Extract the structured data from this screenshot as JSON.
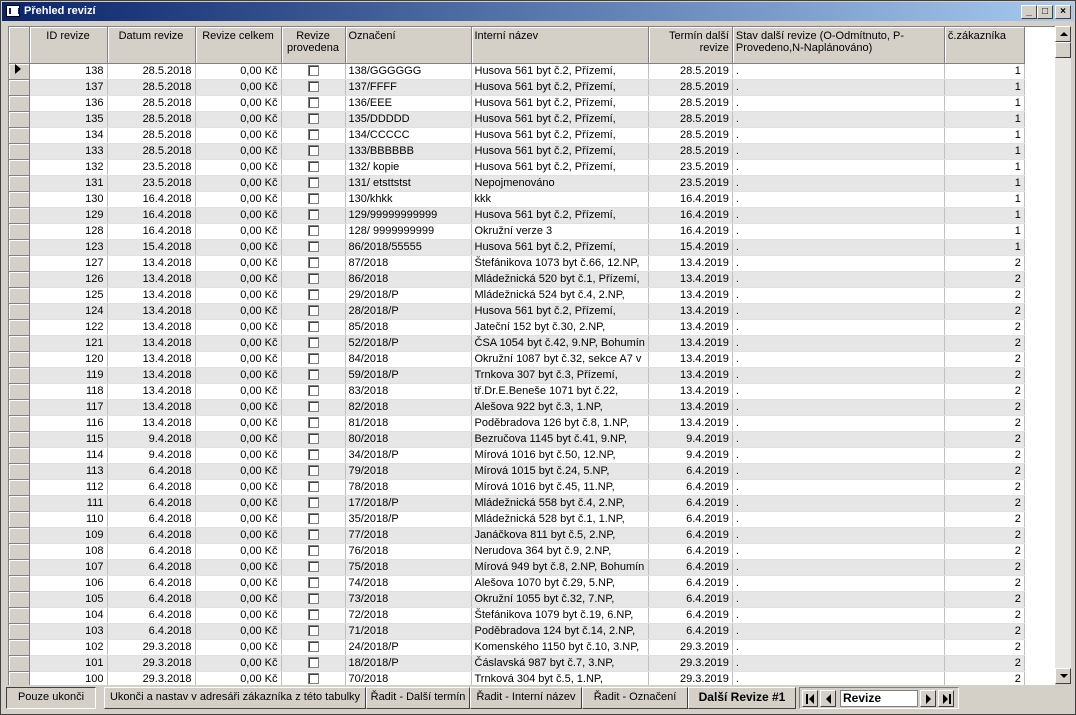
{
  "window": {
    "title": "Přehled revizí",
    "minimize": "_",
    "maximize": "□",
    "close": "×"
  },
  "columns": [
    {
      "key": "id",
      "label": "ID revize"
    },
    {
      "key": "datum",
      "label": "Datum revize"
    },
    {
      "key": "celkem",
      "label": "Revize celkem"
    },
    {
      "key": "provedena",
      "label": "Revize provedena"
    },
    {
      "key": "oznaceni",
      "label": "Označení"
    },
    {
      "key": "nazev",
      "label": "Interní název"
    },
    {
      "key": "termin",
      "label": "Termín další revize"
    },
    {
      "key": "stav",
      "label": "Stav další revize (O-Odmítnuto, P-Provedeno,N-Naplánováno)"
    },
    {
      "key": "zakaznik",
      "label": "č.zákazníka"
    }
  ],
  "rows": [
    [
      "138",
      "28.5.2018",
      "0,00 Kč",
      "138/GGGGGG",
      "Husova 561 byt č.2, Přízemí,",
      "28.5.2019",
      ".",
      "1"
    ],
    [
      "137",
      "28.5.2018",
      "0,00 Kč",
      "137/FFFF",
      "Husova 561 byt č.2, Přízemí,",
      "28.5.2019",
      ".",
      "1"
    ],
    [
      "136",
      "28.5.2018",
      "0,00 Kč",
      "136/EEE",
      "Husova 561 byt č.2, Přízemí,",
      "28.5.2019",
      ".",
      "1"
    ],
    [
      "135",
      "28.5.2018",
      "0,00 Kč",
      "135/DDDDD",
      "Husova 561 byt č.2, Přízemí,",
      "28.5.2019",
      ".",
      "1"
    ],
    [
      "134",
      "28.5.2018",
      "0,00 Kč",
      "134/CCCCC",
      "Husova 561 byt č.2, Přízemí,",
      "28.5.2019",
      ".",
      "1"
    ],
    [
      "133",
      "28.5.2018",
      "0,00 Kč",
      "133/BBBBBB",
      "Husova 561 byt č.2, Přízemí,",
      "28.5.2019",
      ".",
      "1"
    ],
    [
      "132",
      "23.5.2018",
      "0,00 Kč",
      "132/ kopie",
      "Husova 561 byt č.2, Přízemí,",
      "23.5.2019",
      ".",
      "1"
    ],
    [
      "131",
      "23.5.2018",
      "0,00 Kč",
      "131/ etsttstst",
      "Nepojmenováno",
      "23.5.2019",
      ".",
      "1"
    ],
    [
      "130",
      "16.4.2018",
      "0,00 Kč",
      "130/khkk",
      "kkk",
      "16.4.2019",
      ".",
      "1"
    ],
    [
      "129",
      "16.4.2018",
      "0,00 Kč",
      "129/99999999999",
      "Husova 561 byt č.2, Přízemí,",
      "16.4.2019",
      ".",
      "1"
    ],
    [
      "128",
      "16.4.2018",
      "0,00 Kč",
      "128/ 9999999999",
      "Okružní verze 3",
      "16.4.2019",
      ".",
      "1"
    ],
    [
      "123",
      "15.4.2018",
      "0,00 Kč",
      "86/2018/55555",
      "Husova 561 byt č.2, Přízemí,",
      "15.4.2019",
      ".",
      "1"
    ],
    [
      "127",
      "13.4.2018",
      "0,00 Kč",
      "87/2018",
      "Štefánikova 1073 byt č.66, 12.NP,",
      "13.4.2019",
      ".",
      "2"
    ],
    [
      "126",
      "13.4.2018",
      "0,00 Kč",
      "86/2018",
      "Mládežnická 520 byt č.1, Přízemí,",
      "13.4.2019",
      ".",
      "2"
    ],
    [
      "125",
      "13.4.2018",
      "0,00 Kč",
      "29/2018/P",
      "Mládežnická 524 byt č.4, 2.NP,",
      "13.4.2019",
      ".",
      "2"
    ],
    [
      "124",
      "13.4.2018",
      "0,00 Kč",
      "28/2018/P",
      "Husova 561 byt č.2, Přízemí,",
      "13.4.2019",
      ".",
      "2"
    ],
    [
      "122",
      "13.4.2018",
      "0,00 Kč",
      "85/2018",
      "Jateční 152 byt č.30, 2.NP,",
      "13.4.2019",
      ".",
      "2"
    ],
    [
      "121",
      "13.4.2018",
      "0,00 Kč",
      "52/2018/P",
      "ČSA 1054 byt č.42, 9.NP, Bohumín",
      "13.4.2019",
      ".",
      "2"
    ],
    [
      "120",
      "13.4.2018",
      "0,00 Kč",
      "84/2018",
      "Okružní 1087 byt č.32, sekce A7 v",
      "13.4.2019",
      ".",
      "2"
    ],
    [
      "119",
      "13.4.2018",
      "0,00 Kč",
      "59/2018/P",
      "Trnkova 307 byt č.3, Přízemí,",
      "13.4.2019",
      ".",
      "2"
    ],
    [
      "118",
      "13.4.2018",
      "0,00 Kč",
      "83/2018",
      "tř.Dr.E.Beneše 1071 byt č.22,",
      "13.4.2019",
      ".",
      "2"
    ],
    [
      "117",
      "13.4.2018",
      "0,00 Kč",
      "82/2018",
      "Alešova 922 byt č.3, 1.NP,",
      "13.4.2019",
      ".",
      "2"
    ],
    [
      "116",
      "13.4.2018",
      "0,00 Kč",
      "81/2018",
      "Poděbradova 126 byt č.8, 1.NP,",
      "13.4.2019",
      ".",
      "2"
    ],
    [
      "115",
      "9.4.2018",
      "0,00 Kč",
      "80/2018",
      "Bezručova 1145 byt č.41, 9.NP,",
      "9.4.2019",
      ".",
      "2"
    ],
    [
      "114",
      "9.4.2018",
      "0,00 Kč",
      "34/2018/P",
      "Mírová 1016 byt č.50, 12.NP,",
      "9.4.2019",
      ".",
      "2"
    ],
    [
      "113",
      "6.4.2018",
      "0,00 Kč",
      "79/2018",
      "Mírová 1015 byt č.24, 5.NP,",
      "6.4.2019",
      ".",
      "2"
    ],
    [
      "112",
      "6.4.2018",
      "0,00 Kč",
      "78/2018",
      "Mírová 1016 byt č.45, 11.NP,",
      "6.4.2019",
      ".",
      "2"
    ],
    [
      "111",
      "6.4.2018",
      "0,00 Kč",
      "17/2018/P",
      "Mládežnická 558 byt č.4, 2.NP,",
      "6.4.2019",
      ".",
      "2"
    ],
    [
      "110",
      "6.4.2018",
      "0,00 Kč",
      "35/2018/P",
      "Mládežnická 528 byt č.1, 1.NP,",
      "6.4.2019",
      ".",
      "2"
    ],
    [
      "109",
      "6.4.2018",
      "0,00 Kč",
      "77/2018",
      "Janáčkova 811 byt č.5, 2.NP,",
      "6.4.2019",
      ".",
      "2"
    ],
    [
      "108",
      "6.4.2018",
      "0,00 Kč",
      "76/2018",
      "Nerudova 364 byt č.9, 2.NP,",
      "6.4.2019",
      ".",
      "2"
    ],
    [
      "107",
      "6.4.2018",
      "0,00 Kč",
      "75/2018",
      "Mírová 949 byt č.8, 2.NP, Bohumín",
      "6.4.2019",
      ".",
      "2"
    ],
    [
      "106",
      "6.4.2018",
      "0,00 Kč",
      "74/2018",
      "Alešova 1070 byt č.29, 5.NP,",
      "6.4.2019",
      ".",
      "2"
    ],
    [
      "105",
      "6.4.2018",
      "0,00 Kč",
      "73/2018",
      "Okružní 1055 byt č.32, 7.NP,",
      "6.4.2019",
      ".",
      "2"
    ],
    [
      "104",
      "6.4.2018",
      "0,00 Kč",
      "72/2018",
      "Štefánikova 1079 byt č.19, 6.NP,",
      "6.4.2019",
      ".",
      "2"
    ],
    [
      "103",
      "6.4.2018",
      "0,00 Kč",
      "71/2018",
      "Poděbradova 124 byt č.14, 2.NP,",
      "6.4.2019",
      ".",
      "2"
    ],
    [
      "102",
      "29.3.2018",
      "0,00 Kč",
      "24/2018/P",
      "Komenského 1150 byt č.10, 3.NP,",
      "29.3.2019",
      ".",
      "2"
    ],
    [
      "101",
      "29.3.2018",
      "0,00 Kč",
      "18/2018/P",
      "Čáslavská 987 byt č.7, 3.NP,",
      "29.3.2019",
      ".",
      "2"
    ],
    [
      "100",
      "29.3.2018",
      "0,00 Kč",
      "70/2018",
      "Trnková 304 byt č.5, 1.NP,",
      "29.3.2019",
      ".",
      "2"
    ]
  ],
  "buttons": {
    "pouze_ukonci": "Pouze ukonči",
    "ukonci_nastav": "Ukonči a nastav v adresáři zákazníka z této tabulky",
    "radit_termin": "Řadit - Další termín",
    "radit_nazev": "Řadit - Interní název",
    "radit_oznaceni": "Řadit - Označení",
    "dalsi_revize": "Další Revize #1"
  },
  "navigator": {
    "value": "Revize"
  }
}
